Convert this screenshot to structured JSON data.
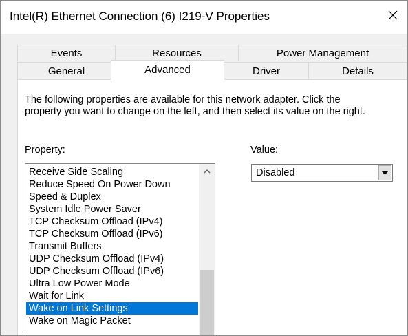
{
  "window": {
    "title": "Intel(R) Ethernet Connection (6) I219-V Properties",
    "close_glyph": "✕"
  },
  "tabs": {
    "row_top": [
      {
        "label": "Events"
      },
      {
        "label": "Resources"
      },
      {
        "label": "Power Management"
      }
    ],
    "row_bottom": [
      {
        "label": "General"
      },
      {
        "label": "Advanced",
        "active": true
      },
      {
        "label": "Driver"
      },
      {
        "label": "Details"
      }
    ]
  },
  "advanced": {
    "description": "The following properties are available for this network adapter. Click the property you want to change on the left, and then select its value on the right.",
    "property_label": "Property:",
    "value_label": "Value:",
    "properties": [
      "Receive Side Scaling",
      "Reduce Speed On Power Down",
      "Speed & Duplex",
      "System Idle Power Saver",
      "TCP Checksum Offload (IPv4)",
      "TCP Checksum Offload (IPv6)",
      "Transmit Buffers",
      "UDP Checksum Offload (IPv4)",
      "UDP Checksum Offload (IPv6)",
      "Ultra Low Power Mode",
      "Wait for Link",
      "Wake on Link Settings",
      "Wake on Magic Packet"
    ],
    "selected_property": "Wake on Link Settings",
    "value_selected": "Disabled"
  },
  "colors": {
    "selection": "#0078d7",
    "dialog_bg": "#f0f0f0",
    "panel_bg": "#ffffff"
  },
  "icons": {
    "close": "close-icon",
    "scroll_up": "chevron-up-icon",
    "dropdown": "caret-down-icon"
  }
}
